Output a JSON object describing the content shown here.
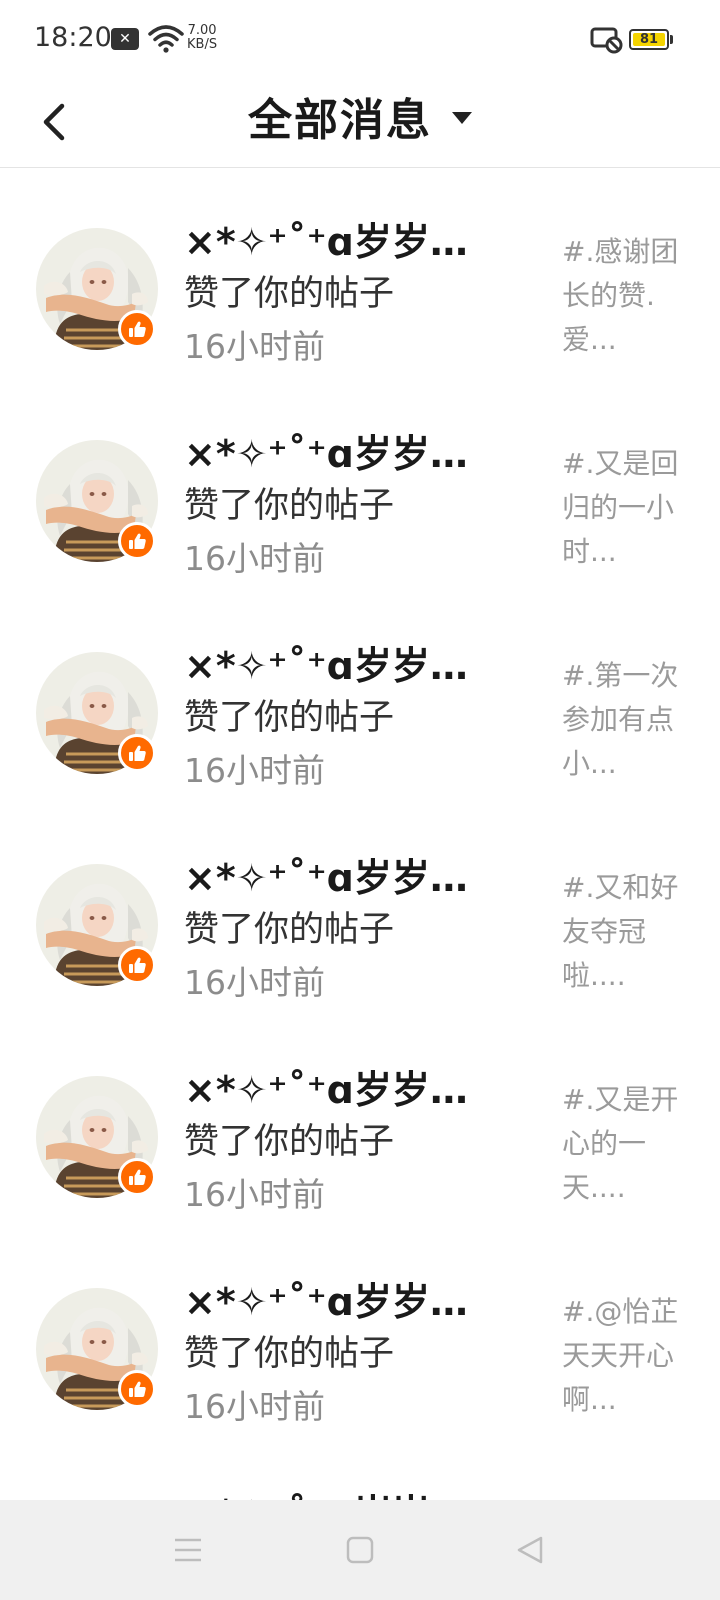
{
  "status_bar": {
    "time": "18:20",
    "notification_icon": "x-notification-icon",
    "speed_value": "7.00",
    "speed_unit": "KB/S",
    "battery": "81",
    "battery_color": "#f5d400"
  },
  "header": {
    "title": "全部消息",
    "back_icon": "chevron-left-icon",
    "dropdown_icon": "caret-down-icon"
  },
  "messages": [
    {
      "name": "×*✧⁺˚⁺ɑ岁岁こ...",
      "action": "赞了你的帖子",
      "time": "16小时前",
      "preview": "#.感谢团长的赞.爱..."
    },
    {
      "name": "×*✧⁺˚⁺ɑ岁岁こ...",
      "action": "赞了你的帖子",
      "time": "16小时前",
      "preview": "#.又是回归的一小时..."
    },
    {
      "name": "×*✧⁺˚⁺ɑ岁岁こ...",
      "action": "赞了你的帖子",
      "time": "16小时前",
      "preview": "#.第一次参加有点小..."
    },
    {
      "name": "×*✧⁺˚⁺ɑ岁岁こ...",
      "action": "赞了你的帖子",
      "time": "16小时前",
      "preview": "#.又和好友夺冠啦...."
    },
    {
      "name": "×*✧⁺˚⁺ɑ岁岁こ...",
      "action": "赞了你的帖子",
      "time": "16小时前",
      "preview": "#.又是开心的一天...."
    },
    {
      "name": "×*✧⁺˚⁺ɑ岁岁こ...",
      "action": "赞了你的帖子",
      "time": "16小时前",
      "preview": "#.@怡芷天天开心啊..."
    },
    {
      "name": "×*✧⁺˚⁺ɑ岁岁こ...",
      "action": "",
      "time": "",
      "preview": ""
    }
  ],
  "colors": {
    "accent": "#ff6a00",
    "preview_text": "#9a9a9a",
    "time_text": "#8c8c8c"
  },
  "nav": {
    "menu_icon": "menu-icon",
    "home_icon": "square-home-icon",
    "back_icon": "triangle-back-icon"
  }
}
